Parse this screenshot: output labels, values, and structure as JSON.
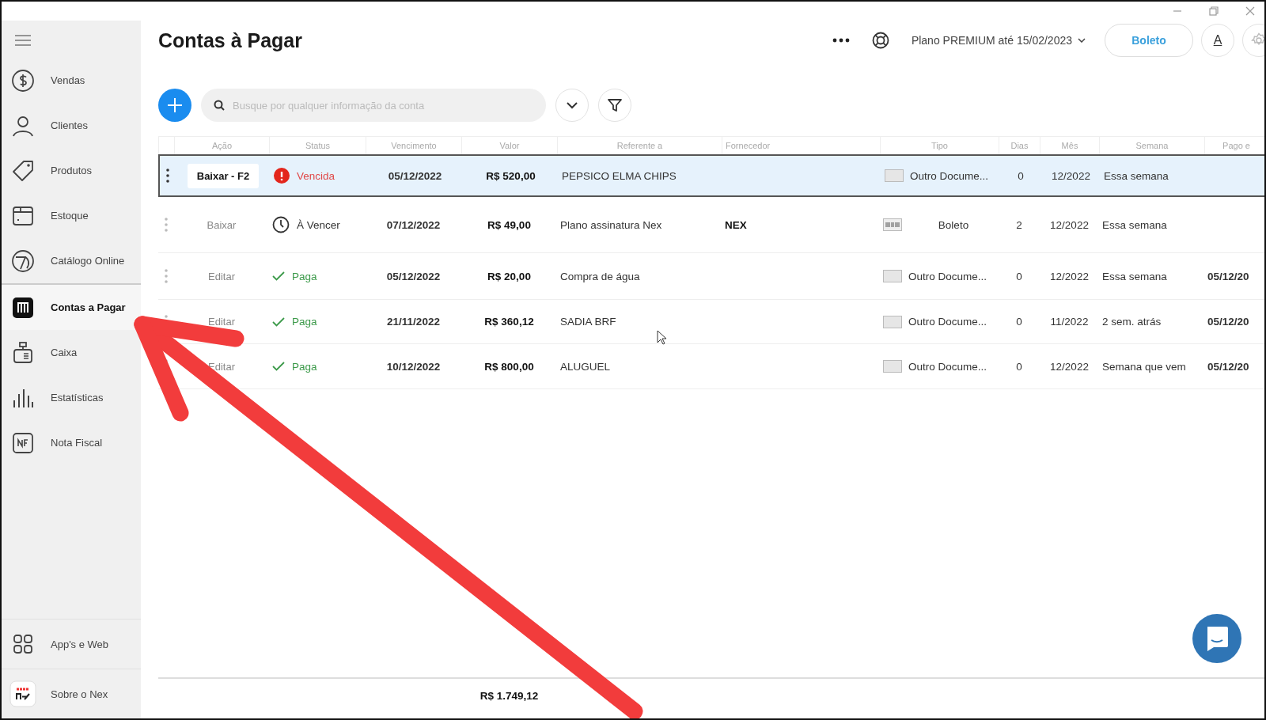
{
  "window": {
    "title": "Contas à Pagar"
  },
  "sidebar": {
    "items": [
      {
        "label": "Vendas",
        "selected": false
      },
      {
        "label": "Clientes",
        "selected": false
      },
      {
        "label": "Produtos",
        "selected": false
      },
      {
        "label": "Estoque",
        "selected": false
      },
      {
        "label": "Catálogo Online",
        "selected": false
      },
      {
        "label": "Contas a Pagar",
        "selected": true
      },
      {
        "label": "Caixa",
        "selected": false
      },
      {
        "label": "Estatísticas",
        "selected": false
      },
      {
        "label": "Nota Fiscal",
        "selected": false
      }
    ],
    "bottom_items": [
      {
        "label": "App's e Web"
      },
      {
        "label": "Sobre o Nex"
      }
    ]
  },
  "header": {
    "plan": "Plano PREMIUM até 15/02/2023",
    "button": "Boleto",
    "font_button": "A"
  },
  "search": {
    "placeholder": "Busque por qualquer informação da conta"
  },
  "table": {
    "columns": [
      "Ação",
      "Status",
      "Vencimento",
      "Valor",
      "Referente a",
      "Fornecedor",
      "Tipo",
      "Dias",
      "Mês",
      "Semana",
      "Pago e"
    ],
    "rows": [
      {
        "selected": true,
        "action": {
          "kind": "shortcut",
          "label": "Baixar - F2"
        },
        "status": {
          "kind": "overdue",
          "label": "Vencida"
        },
        "due": "05/12/2022",
        "value": "R$ 520,00",
        "ref": "PEPSICO ELMA CHIPS",
        "supplier": "",
        "type": {
          "kind": "other",
          "label": "Outro Docume..."
        },
        "days": "0",
        "month": "12/2022",
        "week": "Essa semana",
        "paid": ""
      },
      {
        "selected": false,
        "action": {
          "kind": "plain",
          "label": "Baixar"
        },
        "status": {
          "kind": "due",
          "label": "À Vencer"
        },
        "due": "07/12/2022",
        "value": "R$ 49,00",
        "ref": "Plano assinatura Nex",
        "supplier": "NEX",
        "type": {
          "kind": "boleto",
          "label": "Boleto"
        },
        "days": "2",
        "month": "12/2022",
        "week": "Essa semana",
        "paid": ""
      },
      {
        "selected": false,
        "action": {
          "kind": "plain",
          "label": "Editar"
        },
        "status": {
          "kind": "paid",
          "label": "Paga"
        },
        "due": "05/12/2022",
        "value": "R$ 20,00",
        "ref": "Compra de água",
        "supplier": "",
        "type": {
          "kind": "other",
          "label": "Outro Docume..."
        },
        "days": "0",
        "month": "12/2022",
        "week": "Essa semana",
        "paid": "05/12/20"
      },
      {
        "selected": false,
        "action": {
          "kind": "plain",
          "label": "Editar"
        },
        "status": {
          "kind": "paid",
          "label": "Paga"
        },
        "due": "21/11/2022",
        "value": "R$ 360,12",
        "ref": "SADIA BRF",
        "supplier": "",
        "type": {
          "kind": "other",
          "label": "Outro Docume..."
        },
        "days": "0",
        "month": "11/2022",
        "week": "2 sem. atrás",
        "paid": "05/12/20"
      },
      {
        "selected": false,
        "action": {
          "kind": "plain",
          "label": "Editar"
        },
        "status": {
          "kind": "paid",
          "label": "Paga"
        },
        "due": "10/12/2022",
        "value": "R$ 800,00",
        "ref": "ALUGUEL",
        "supplier": "",
        "type": {
          "kind": "other",
          "label": "Outro Docume..."
        },
        "days": "0",
        "month": "12/2022",
        "week": "Semana que vem",
        "paid": "05/12/20"
      }
    ],
    "total": "R$ 1.749,12"
  }
}
